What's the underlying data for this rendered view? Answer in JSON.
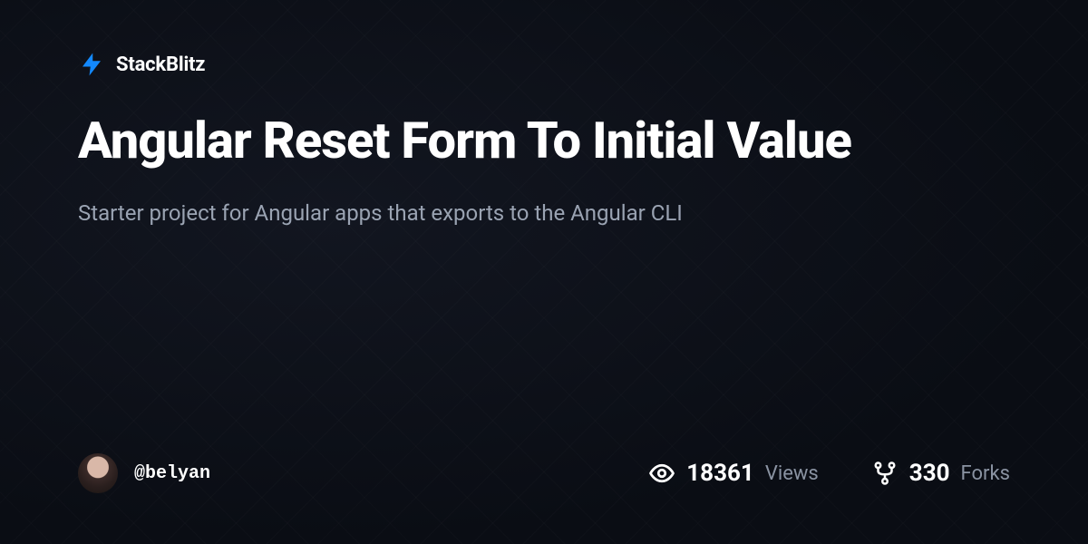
{
  "brand": {
    "name": "StackBlitz",
    "icon": "bolt-icon"
  },
  "project": {
    "title": "Angular Reset Form To Initial Value",
    "description": "Starter project for Angular apps that exports to the Angular CLI"
  },
  "author": {
    "handle": "@belyan"
  },
  "stats": {
    "views": {
      "value": "18361",
      "label": "Views"
    },
    "forks": {
      "value": "330",
      "label": "Forks"
    }
  },
  "colors": {
    "accent": "#1389fd",
    "bg": "#0a0d14",
    "muted": "#9aa3b2"
  }
}
